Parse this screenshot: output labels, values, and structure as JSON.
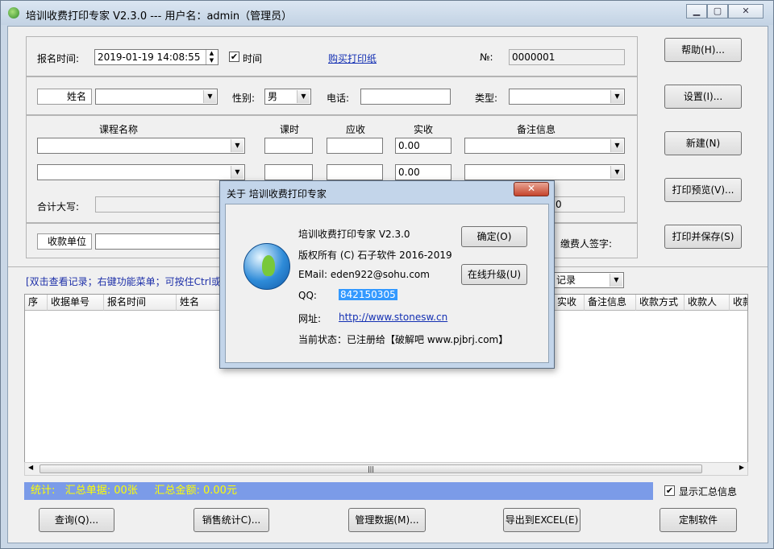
{
  "window": {
    "title": "培训收费打印专家 V2.3.0 --- 用户名：admin（管理员）"
  },
  "form": {
    "reg_time_label": "报名时间:",
    "reg_time_value": "2019-01-19 14:08:55",
    "time_check_label": "时间",
    "time_checked": "✔",
    "buy_paper_link": "购买打印纸",
    "no_label": "№:",
    "no_value": "0000001",
    "name_label": "姓名",
    "gender_label": "性别:",
    "gender_value": "男",
    "phone_label": "电话:",
    "type_label": "类型:",
    "course_name_header": "课程名称",
    "hours_header": "课时",
    "due_header": "应收",
    "paid_header": "实收",
    "note_header": "备注信息",
    "paid_value_1": "0.00",
    "paid_value_2": "0.00",
    "total_caps_label": "合计大写:",
    "total_partial_value": "0",
    "payee_unit_label": "收款单位",
    "payer_sign_label": "缴费人签字:"
  },
  "right_buttons": {
    "help": "帮助(H)...",
    "settings": "设置(I)...",
    "new": "新建(N)",
    "print_preview": "打印预览(V)...",
    "print_save": "打印并保存(S)"
  },
  "records": {
    "hint": "[双击查看记录；右键功能菜单；可按住Ctrl或S",
    "filter_value": "记录",
    "columns": [
      "序",
      "收据单号",
      "报名时间",
      "姓名",
      "实收",
      "备注信息",
      "收款方式",
      "收款人",
      "收款"
    ]
  },
  "status": {
    "text": "统计:   汇总单据: 00张     汇总金额: 0.00元",
    "show_summary_label": "显示汇总信息",
    "show_summary_checked": "✔"
  },
  "bottom_buttons": {
    "query": "查询(Q)...",
    "sales_stats": "销售统计C)...",
    "manage_data": "管理数据(M)...",
    "export_excel": "导出到EXCEL(E)",
    "customize": "定制软件"
  },
  "about_dialog": {
    "title": "关于 培训收费打印专家",
    "close_glyph": "✕",
    "product": "培训收费打印专家 V2.3.0",
    "copyright": "版权所有 (C) 石子软件 2016-2019",
    "email": "EMail: eden922@sohu.com",
    "qq_label": "QQ:",
    "qq_value": "842150305",
    "site_label": "网址:",
    "site_url": "http://www.stonesw.cn",
    "state": "当前状态：已注册给【破解吧 www.pjbrj.com】",
    "ok_button": "确定(O)",
    "upgrade_button": "在线升级(U)"
  }
}
